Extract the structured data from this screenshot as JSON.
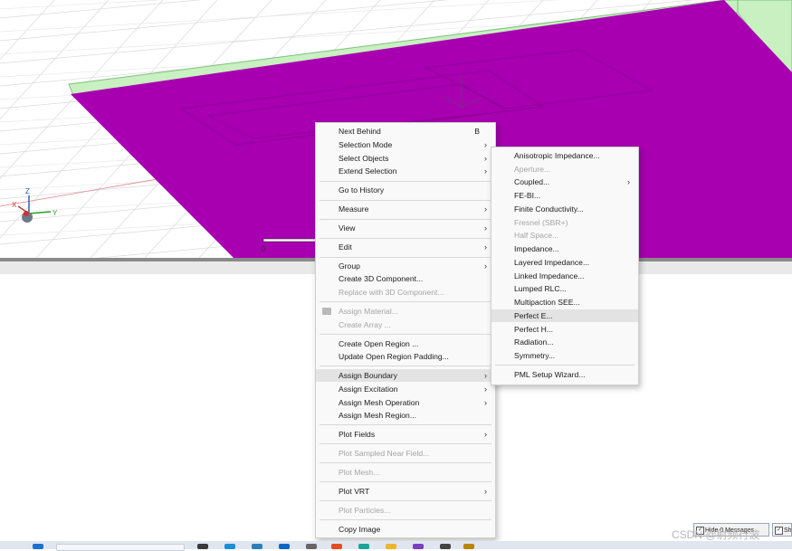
{
  "viewport": {
    "scale_label": "0"
  },
  "context_menu": [
    {
      "label": "Next Behind",
      "shortcut": "B",
      "submenu": false,
      "disabled": false
    },
    {
      "label": "Selection Mode",
      "submenu": true,
      "disabled": false
    },
    {
      "label": "Select Objects",
      "submenu": true,
      "disabled": false
    },
    {
      "label": "Extend Selection",
      "submenu": true,
      "disabled": false
    },
    {
      "label": "Go to History",
      "submenu": false,
      "disabled": false
    },
    {
      "label": "Measure",
      "submenu": true,
      "disabled": false
    },
    {
      "label": "View",
      "submenu": true,
      "disabled": false
    },
    {
      "label": "Edit",
      "submenu": true,
      "disabled": false
    },
    {
      "label": "Group",
      "submenu": true,
      "disabled": false
    },
    {
      "label": "Create 3D Component...",
      "submenu": false,
      "disabled": false
    },
    {
      "label": "Replace with 3D Component...",
      "submenu": false,
      "disabled": true
    },
    {
      "label": "Assign Material...",
      "submenu": false,
      "disabled": true
    },
    {
      "label": "Create Array ...",
      "submenu": false,
      "disabled": true
    },
    {
      "label": "Create Open Region ...",
      "submenu": false,
      "disabled": false
    },
    {
      "label": "Update Open Region Padding...",
      "submenu": false,
      "disabled": false
    },
    {
      "label": "Assign Boundary",
      "submenu": true,
      "disabled": false,
      "highlighted": true
    },
    {
      "label": "Assign Excitation",
      "submenu": true,
      "disabled": false
    },
    {
      "label": "Assign Mesh Operation",
      "submenu": true,
      "disabled": false
    },
    {
      "label": "Assign Mesh Region...",
      "submenu": false,
      "disabled": false
    },
    {
      "label": "Plot Fields",
      "submenu": true,
      "disabled": false
    },
    {
      "label": "Plot Sampled Near Field...",
      "submenu": false,
      "disabled": true
    },
    {
      "label": "Plot Mesh...",
      "submenu": false,
      "disabled": true
    },
    {
      "label": "Plot VRT",
      "submenu": true,
      "disabled": false
    },
    {
      "label": "Plot Particles...",
      "submenu": false,
      "disabled": true
    },
    {
      "label": "Copy Image",
      "submenu": false,
      "disabled": false
    }
  ],
  "boundary_submenu": [
    {
      "label": "Anisotropic Impedance...",
      "submenu": false,
      "disabled": false
    },
    {
      "label": "Aperture...",
      "submenu": false,
      "disabled": true
    },
    {
      "label": "Coupled...",
      "submenu": true,
      "disabled": false
    },
    {
      "label": "FE-BI...",
      "submenu": false,
      "disabled": false
    },
    {
      "label": "Finite Conductivity...",
      "submenu": false,
      "disabled": false
    },
    {
      "label": "Fresnel (SBR+)",
      "submenu": false,
      "disabled": true
    },
    {
      "label": "Half Space...",
      "submenu": false,
      "disabled": true
    },
    {
      "label": "Impedance...",
      "submenu": false,
      "disabled": false
    },
    {
      "label": "Layered Impedance...",
      "submenu": false,
      "disabled": false
    },
    {
      "label": "Linked Impedance...",
      "submenu": false,
      "disabled": false
    },
    {
      "label": "Lumped RLC...",
      "submenu": false,
      "disabled": false
    },
    {
      "label": "Multipaction SEE...",
      "submenu": false,
      "disabled": false
    },
    {
      "label": "Perfect E...",
      "submenu": false,
      "disabled": false,
      "highlighted": true
    },
    {
      "label": "Perfect H...",
      "submenu": false,
      "disabled": false
    },
    {
      "label": "Radiation...",
      "submenu": false,
      "disabled": false
    },
    {
      "label": "Symmetry...",
      "submenu": false,
      "disabled": false
    },
    {
      "label": "PML Setup Wizard...",
      "submenu": false,
      "disabled": false
    }
  ],
  "status": {
    "messages_label": "Hide 0 Messages",
    "second_label": "Sh"
  },
  "watermark": "CSDN @射频行波",
  "colors": {
    "plate": "#a800b0",
    "substrate_edge": "#c8f0c0",
    "grid": "#d8d8d8",
    "menu_bg": "#f9f9f9"
  },
  "icons": [
    "submenu-arrow-icon",
    "assign-material-icon",
    "axis-triad-icon",
    "windows-start-icon",
    "search-icon"
  ]
}
